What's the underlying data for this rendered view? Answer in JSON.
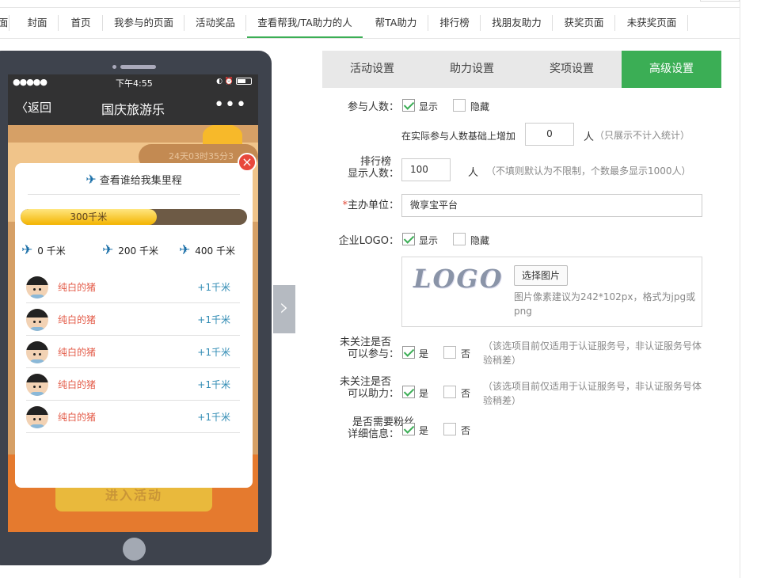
{
  "top_tabs": [
    {
      "label": "面",
      "active": false
    },
    {
      "label": "封面",
      "active": false
    },
    {
      "label": "首页",
      "active": false
    },
    {
      "label": "我参与的页面",
      "active": false
    },
    {
      "label": "活动奖品",
      "active": false
    },
    {
      "label": "查看帮我/TA助力的人",
      "active": true
    },
    {
      "label": "帮TA助力",
      "active": false
    },
    {
      "label": "排行榜",
      "active": false
    },
    {
      "label": "找朋友助力",
      "active": false
    },
    {
      "label": "获奖页面",
      "active": false
    },
    {
      "label": "未获奖页面",
      "active": false
    }
  ],
  "phone": {
    "status_dots": "●●●●●",
    "status_time": "下午4:55",
    "status_icons": "◐ ⏰",
    "back_label": "返回",
    "title": "国庆旅游乐",
    "more": "•••",
    "countdown": "24天03时35分3",
    "enter_button": "进入活动"
  },
  "modal": {
    "title": "查看谁给我集里程",
    "progress_label": "300千米",
    "progress_fraction": 0.6,
    "milestones": [
      "0 千米",
      "200 千米",
      "400 千米"
    ],
    "rows": [
      {
        "name": "纯白的猪",
        "km": "+1千米"
      },
      {
        "name": "纯白的猪",
        "km": "+1千米"
      },
      {
        "name": "纯白的猪",
        "km": "+1千米"
      },
      {
        "name": "纯白的猪",
        "km": "+1千米"
      },
      {
        "name": "纯白的猪",
        "km": "+1千米"
      }
    ]
  },
  "settings_tabs": [
    {
      "label": "活动设置",
      "active": false
    },
    {
      "label": "助力设置",
      "active": false
    },
    {
      "label": "奖项设置",
      "active": false
    },
    {
      "label": "高级设置",
      "active": true
    }
  ],
  "form": {
    "participants_label": "参与人数：",
    "show": "显示",
    "hide": "隐藏",
    "add_base_label": "在实际参与人数基础上增加",
    "add_base_value": "0",
    "person_unit": "人",
    "add_base_hint": "（只展示不计入统计）",
    "rank_label_1": "排行榜",
    "rank_label_2": "显示人数：",
    "rank_value": "100",
    "rank_hint": "（不填则默认为不限制，个数最多显示1000人）",
    "host_required_mark": "*",
    "host_label": "主办单位：",
    "host_value": "微享宝平台",
    "logo_label": "企业LOGO：",
    "logo_text": "LOGO",
    "pick_image": "选择图片",
    "logo_hint": "图片像素建议为242*102px，格式为jpg或png",
    "unfollow_join_1": "未关注是否",
    "unfollow_join_2": "可以参与：",
    "unfollow_help_1": "未关注是否",
    "unfollow_help_2": "可以助力：",
    "yes": "是",
    "no": "否",
    "service_hint": "（该选项目前仅适用于认证服务号，非认证服务号体验稍差）",
    "fans_info_1": "是否需要粉丝",
    "fans_info_2": "详细信息："
  },
  "colors": {
    "accent": "#3bae55",
    "required": "#e34b3a",
    "link_blue": "#2e8ab3",
    "name_red": "#e35a47"
  }
}
